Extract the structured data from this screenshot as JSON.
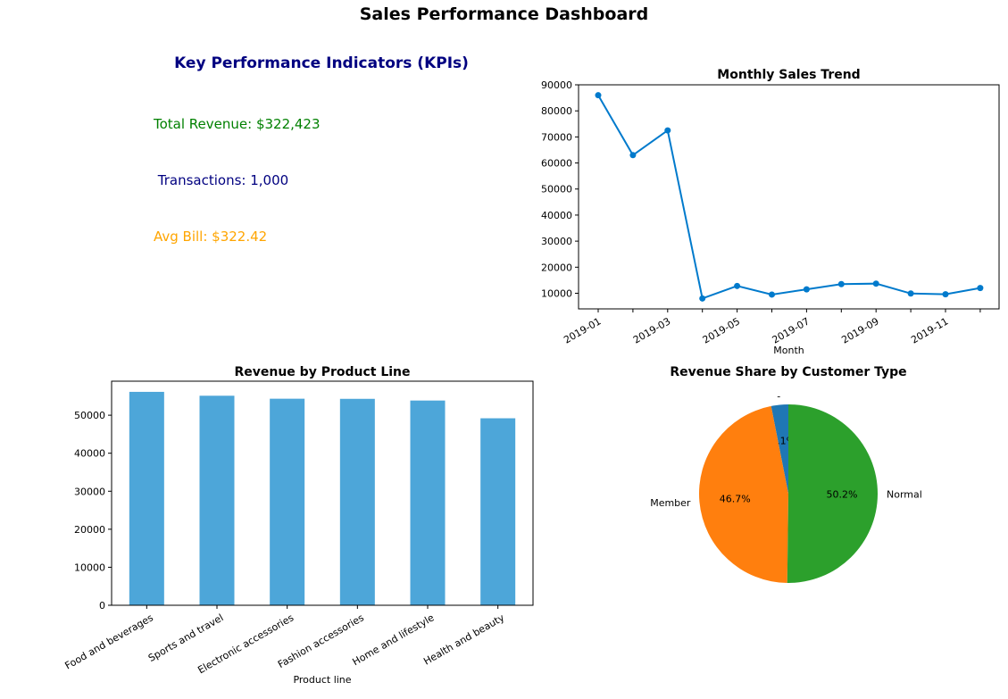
{
  "dashboard_title": "Sales Performance Dashboard",
  "kpi": {
    "title": "Key Performance Indicators (KPIs)",
    "title_color": "#000080",
    "items": [
      {
        "text": "Total Revenue: $322,423",
        "color": "#008000"
      },
      {
        "text": " Transactions: 1,000",
        "color": "#000080"
      },
      {
        "text": "Avg Bill: $322.42",
        "color": "#ffa500"
      }
    ]
  },
  "chart_data": [
    {
      "type": "line",
      "title": "Monthly Sales Trend",
      "xlabel": "Month",
      "ylabel": "",
      "x": [
        "2019-01",
        "2019-02",
        "2019-03",
        "2019-04",
        "2019-05",
        "2019-06",
        "2019-07",
        "2019-08",
        "2019-09",
        "2019-10",
        "2019-11",
        "2019-12"
      ],
      "values": [
        86000,
        63000,
        72500,
        8000,
        12800,
        9500,
        11500,
        13500,
        13700,
        9900,
        9600,
        12000
      ],
      "x_tick_labels": [
        "2019-01",
        "2019-03",
        "2019-05",
        "2019-07",
        "2019-09",
        "2019-11"
      ],
      "y_ticks": [
        10000,
        20000,
        30000,
        40000,
        50000,
        60000,
        70000,
        80000,
        90000
      ],
      "ylim": [
        4000,
        90000
      ],
      "color": "#007acc",
      "grid": false
    },
    {
      "type": "bar",
      "title": "Revenue by Product Line",
      "xlabel": "Product line",
      "ylabel": "",
      "categories": [
        "Food and beverages",
        "Sports and travel",
        "Electronic accessories",
        "Fashion accessories",
        "Home and lifestyle",
        "Health and beauty"
      ],
      "values": [
        56145,
        55123,
        54338,
        54306,
        53862,
        49194
      ],
      "y_ticks": [
        0,
        10000,
        20000,
        30000,
        40000,
        50000
      ],
      "ylim": [
        0,
        58950
      ],
      "color": "#4da6d9",
      "grid": false
    },
    {
      "type": "pie",
      "title": "Revenue Share by Customer Type",
      "slices": [
        {
          "label": "-",
          "value": 3.1,
          "pct_label": "3.1%",
          "color": "#1f77b4"
        },
        {
          "label": "Member",
          "value": 46.7,
          "pct_label": "46.7%",
          "color": "#ff7f0e"
        },
        {
          "label": "Normal",
          "value": 50.2,
          "pct_label": "50.2%",
          "color": "#2ca02c"
        }
      ]
    }
  ]
}
